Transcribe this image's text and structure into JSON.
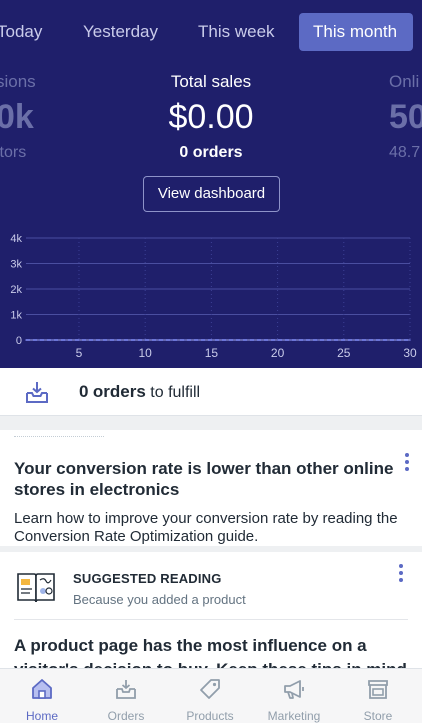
{
  "periods": {
    "today": "Today",
    "yesterday": "Yesterday",
    "this_week": "This week",
    "this_month": "This month",
    "selected": "This month"
  },
  "metrics": {
    "left": {
      "label": "sions",
      "value": "0k",
      "sub": "itors"
    },
    "center": {
      "label": "Total sales",
      "value": "$0.00",
      "sub": "0 orders"
    },
    "right": {
      "label": "Onli",
      "value": "50",
      "sub": "48.7"
    }
  },
  "dashboard_button": "View dashboard",
  "chart_data": {
    "type": "line",
    "x": [
      1,
      2,
      3,
      4,
      5,
      6,
      7,
      8,
      9,
      10,
      11,
      12,
      13,
      14,
      15,
      16,
      17,
      18,
      19,
      20,
      21,
      22,
      23,
      24,
      25,
      26,
      27,
      28,
      29,
      30
    ],
    "series": [
      {
        "values": [
          0,
          0,
          0,
          0,
          0,
          0,
          0,
          0,
          0,
          0,
          0,
          0,
          0,
          0,
          0,
          0,
          0,
          0,
          0,
          0,
          0,
          0,
          0,
          0,
          0,
          0,
          0,
          0,
          0,
          0
        ]
      }
    ],
    "y_ticks": [
      "0",
      "1k",
      "2k",
      "3k",
      "4k"
    ],
    "x_ticks": [
      "5",
      "10",
      "15",
      "20",
      "25",
      "30"
    ],
    "ylim": [
      0,
      4000
    ],
    "xlim": [
      1,
      30
    ],
    "grid": true
  },
  "fulfill": {
    "count": "0",
    "strong": "orders",
    "rest": "to fulfill"
  },
  "insight_card": {
    "title": "Your conversion rate is lower than other online stores in electronics",
    "body": "Learn how to improve your conversion rate by reading the Conversion Rate Optimization guide."
  },
  "reading_card": {
    "kicker": "SUGGESTED READING",
    "reason": "Because you added a product",
    "headline": "A product page has the most influence on a visitor's decision to buy. Keep these tips in mind"
  },
  "nav": {
    "items": [
      {
        "label": "Home",
        "icon": "home-icon"
      },
      {
        "label": "Orders",
        "icon": "inbox-download-icon"
      },
      {
        "label": "Products",
        "icon": "tag-icon"
      },
      {
        "label": "Marketing",
        "icon": "megaphone-icon"
      },
      {
        "label": "Store",
        "icon": "storefront-icon"
      }
    ],
    "active": "Home"
  },
  "colors": {
    "hero_bg": "#1f1f6b",
    "accent": "#5c6ac4",
    "text": "#212b36",
    "muted": "#919eab"
  }
}
